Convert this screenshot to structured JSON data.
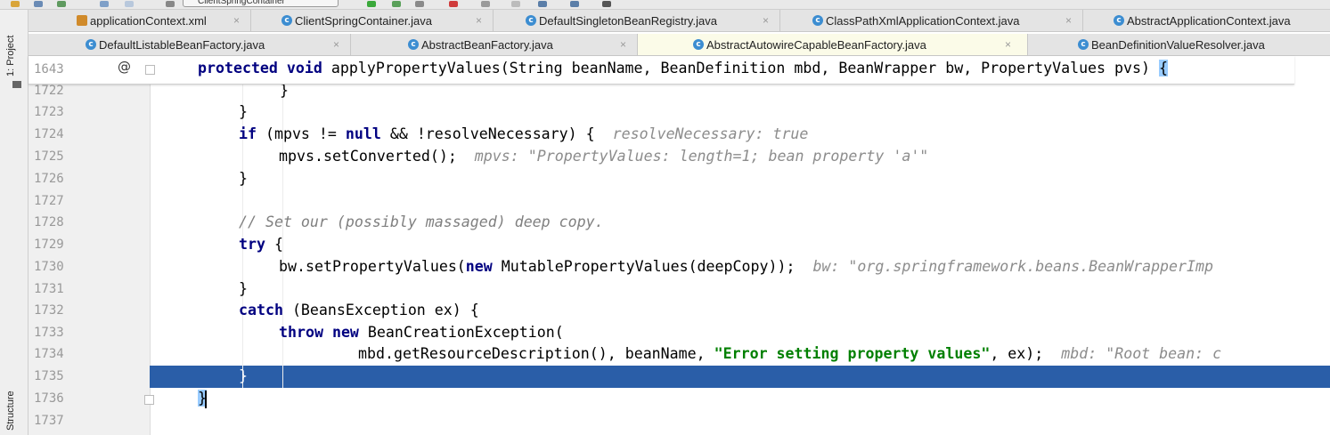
{
  "toolbar": {
    "run_config": "ClientSpringContainer"
  },
  "left_strip": {
    "project_label": "1: Project",
    "structure_label": "Structure"
  },
  "tabs_row1": [
    {
      "label": "applicationContext.xml",
      "icon": "xml-file-icon"
    },
    {
      "label": "ClientSpringContainer.java",
      "icon": "class-icon"
    },
    {
      "label": "DefaultSingletonBeanRegistry.java",
      "icon": "class-icon"
    },
    {
      "label": "ClassPathXmlApplicationContext.java",
      "icon": "class-icon"
    },
    {
      "label": "AbstractApplicationContext.java",
      "icon": "class-icon"
    }
  ],
  "tabs_row2": [
    {
      "label": "DefaultListableBeanFactory.java",
      "icon": "class-icon"
    },
    {
      "label": "AbstractBeanFactory.java",
      "icon": "class-icon"
    },
    {
      "label": "AbstractAutowireCapableBeanFactory.java",
      "icon": "class-icon",
      "active": true
    },
    {
      "label": "BeanDefinitionValueResolver.java",
      "icon": "class-icon"
    }
  ],
  "icon_glyphs": {
    "class": "c",
    "close": "×",
    "annotation": "@"
  },
  "sticky": {
    "line": "1643",
    "kw1": "protected",
    "kw2": "void",
    "text": " applyPropertyValues(String beanName, BeanDefinition mbd, BeanWrapper bw, PropertyValues pvs) ",
    "brace": "{"
  },
  "lines": [
    {
      "n": "1722",
      "t1": "}"
    },
    {
      "n": "1723",
      "t1": "}"
    },
    {
      "n": "1724",
      "kw_if": "if",
      "t1": " (mpvs != ",
      "kw_null": "null",
      "t2": " && !resolveNecessary) {",
      "hint": "resolveNecessary: true"
    },
    {
      "n": "1725",
      "t1": "mpvs.setConverted();",
      "hint": "mpvs: \"PropertyValues: length=1; bean property 'a'\""
    },
    {
      "n": "1726",
      "t1": "}"
    },
    {
      "n": "1727"
    },
    {
      "n": "1728",
      "comment": "// Set our (possibly massaged) deep copy."
    },
    {
      "n": "1729",
      "kw_try": "try",
      "t1": " {"
    },
    {
      "n": "1730",
      "t1": "bw.setPropertyValues(",
      "kw_new": "new",
      "t2": " MutablePropertyValues(deepCopy));",
      "hint": "bw: \"org.springframework.beans.BeanWrapperImp"
    },
    {
      "n": "1731",
      "t1": "}"
    },
    {
      "n": "1732",
      "kw_catch": "catch",
      "t1": " (BeansException ex) {"
    },
    {
      "n": "1733",
      "kw_throw": "throw",
      "kw_new": "new",
      "t1": " BeanCreationException("
    },
    {
      "n": "1734",
      "t1": "mbd.getResourceDescription(), beanName, ",
      "str": "\"Error setting property values\"",
      "t2": ", ex);",
      "hint": "mbd: \"Root bean: c"
    },
    {
      "n": "1735",
      "t1": "}"
    },
    {
      "n": "1736",
      "t1": "}"
    },
    {
      "n": "1737"
    }
  ],
  "colors": {
    "keyword": "#000080",
    "string": "#008000",
    "comment": "#808080",
    "selection": "#2a5ea8",
    "active_tab": "#fbfbe8"
  }
}
